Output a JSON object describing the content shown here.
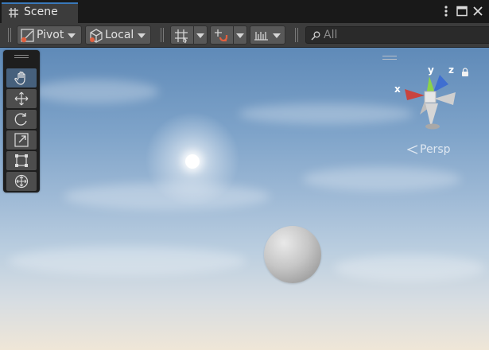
{
  "tab": {
    "label": "Scene",
    "icon": "grid-icon"
  },
  "window_controls": [
    "kebab-menu-icon",
    "maximize-icon",
    "close-icon"
  ],
  "toolbar": {
    "pivot_label": "Pivot",
    "local_label": "Local",
    "search_placeholder": "All"
  },
  "tools": [
    "hand-tool",
    "move-tool",
    "rotate-tool",
    "scale-tool",
    "rect-tool",
    "transform-tool"
  ],
  "active_tool": "hand-tool",
  "gizmo": {
    "x_label": "x",
    "y_label": "y",
    "z_label": "z",
    "projection_label": "Persp"
  },
  "colors": {
    "accent": "#3a79bb",
    "x_axis": "#c9443f",
    "y_axis": "#8bd34a",
    "z_axis": "#3f6fd1"
  }
}
